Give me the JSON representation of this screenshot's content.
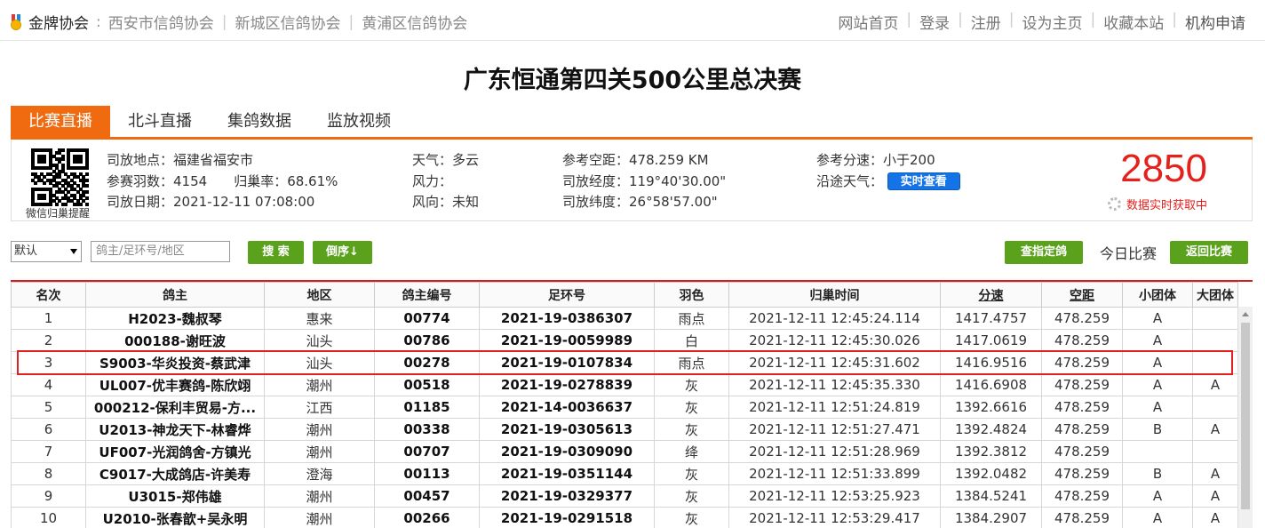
{
  "topbar": {
    "brand": "金牌协会",
    "sep": ":",
    "associations": [
      "西安市信鸽协会",
      "新城区信鸽协会",
      "黄浦区信鸽协会"
    ],
    "links": [
      "网站首页",
      "登录",
      "注册",
      "设为主页",
      "收藏本站",
      "机构申请"
    ]
  },
  "title": "广东恒通第四关500公里总决赛",
  "tabs": [
    "比赛直播",
    "北斗直播",
    "集鸽数据",
    "监放视频"
  ],
  "info": {
    "qr_label": "微信归巢提醒",
    "release_place": "司放地点：福建省福安市",
    "entries": "参赛羽数：4154",
    "return_rate": "归巢率：68.61%",
    "release_date": "司放日期：2021-12-11 07:08:00",
    "weather": "天气：多云",
    "wind_force": "风力：",
    "wind_dir": "风向：未知",
    "ref_distance": "参考空距：478.259 KM",
    "longitude": "司放经度：119°40'30.00\"",
    "latitude": "司放纬度：26°58'57.00\"",
    "ref_speed": "参考分速：小于200",
    "route_weather": "沿途天气：",
    "realtime_btn": "实时查看",
    "count": "2850",
    "live_text": "数据实时获取中"
  },
  "search": {
    "select_value": "默认",
    "placeholder": "鸽主/足环号/地区",
    "search_btn": "搜 索",
    "sort_btn": "倒序↓",
    "locate_btn": "查指定鸽",
    "today": "今日比赛",
    "back_btn": "返回比赛"
  },
  "table": {
    "headers": [
      "名次",
      "鸽主",
      "地区",
      "鸽主编号",
      "足环号",
      "羽色",
      "归巢时间",
      "分速",
      "空距",
      "小团体",
      "大团体"
    ],
    "rows": [
      [
        "1",
        "H2023-魏叔琴",
        "惠来",
        "00774",
        "2021-19-0386307",
        "雨点",
        "2021-12-11 12:45:24.114",
        "1417.4757",
        "478.259",
        "A",
        ""
      ],
      [
        "2",
        "000188-谢旺波",
        "汕头",
        "00786",
        "2021-19-0059989",
        "白",
        "2021-12-11 12:45:30.026",
        "1417.0619",
        "478.259",
        "A",
        ""
      ],
      [
        "3",
        "S9003-华炎投资-蔡武津",
        "汕头",
        "00278",
        "2021-19-0107834",
        "雨点",
        "2021-12-11 12:45:31.602",
        "1416.9516",
        "478.259",
        "A",
        ""
      ],
      [
        "4",
        "UL007-优丰赛鸽-陈欣翊",
        "潮州",
        "00518",
        "2021-19-0278839",
        "灰",
        "2021-12-11 12:45:35.330",
        "1416.6908",
        "478.259",
        "A",
        "A"
      ],
      [
        "5",
        "000212-保利丰贸易-方...",
        "江西",
        "01185",
        "2021-14-0036637",
        "灰",
        "2021-12-11 12:51:24.819",
        "1392.6616",
        "478.259",
        "A",
        ""
      ],
      [
        "6",
        "U2013-神龙天下-林睿烨",
        "潮州",
        "00338",
        "2021-19-0305613",
        "灰",
        "2021-12-11 12:51:27.471",
        "1392.4824",
        "478.259",
        "B",
        "A"
      ],
      [
        "7",
        "UF007-光润鸽舍-方镇光",
        "潮州",
        "00707",
        "2021-19-0309090",
        "绛",
        "2021-12-11 12:51:28.969",
        "1392.3812",
        "478.259",
        "",
        ""
      ],
      [
        "8",
        "C9017-大成鸽店-许美寿",
        "澄海",
        "00113",
        "2021-19-0351144",
        "灰",
        "2021-12-11 12:51:33.899",
        "1392.0482",
        "478.259",
        "B",
        "A"
      ],
      [
        "9",
        "U3015-郑伟雄",
        "潮州",
        "00457",
        "2021-19-0329377",
        "灰",
        "2021-12-11 12:53:25.923",
        "1384.5241",
        "478.259",
        "A",
        "A"
      ],
      [
        "10",
        "U2010-张春歆+吴永明",
        "潮州",
        "00266",
        "2021-19-0291518",
        "灰",
        "2021-12-11 12:53:29.417",
        "1384.2907",
        "478.259",
        "A",
        "A"
      ]
    ]
  }
}
